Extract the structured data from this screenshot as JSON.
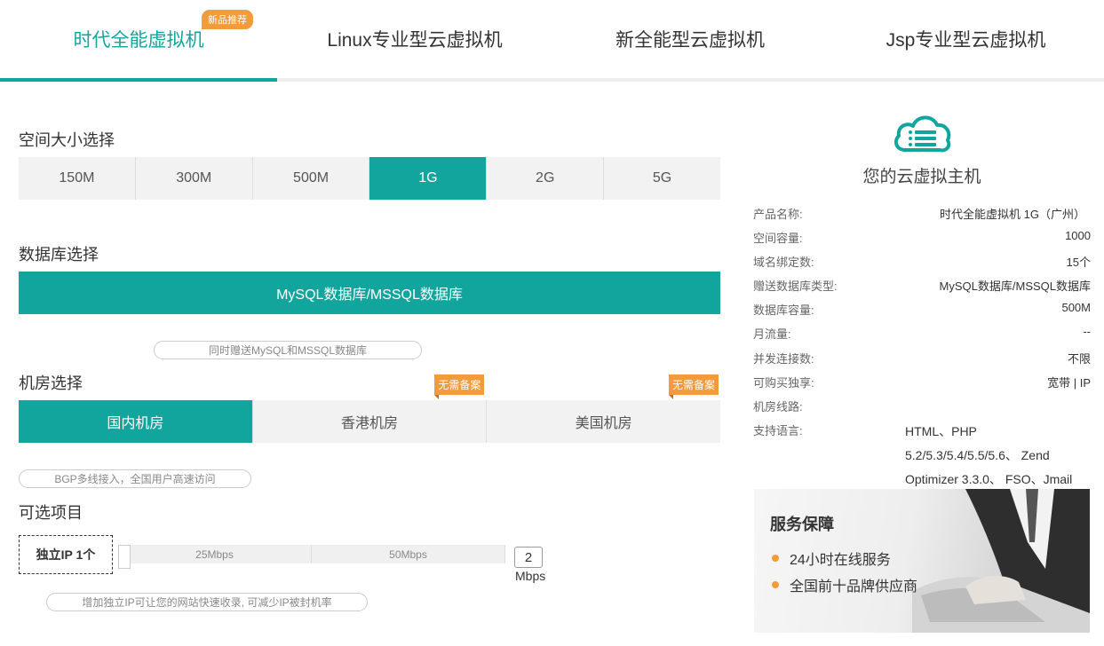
{
  "tabs": [
    {
      "label": "时代全能虚拟机",
      "badge": "新品推荐",
      "active": true
    },
    {
      "label": "Linux专业型云虚拟机"
    },
    {
      "label": "新全能型云虚拟机"
    },
    {
      "label": "Jsp专业型云虚拟机"
    }
  ],
  "space": {
    "title": "空间大小选择",
    "options": [
      "150M",
      "300M",
      "500M",
      "1G",
      "2G",
      "5G"
    ],
    "selected": "1G"
  },
  "database": {
    "title": "数据库选择",
    "option": "MySQL数据库/MSSQL数据库",
    "note": "同时赠送MySQL和MSSQL数据库"
  },
  "room": {
    "title": "机房选择",
    "options": [
      "国内机房",
      "香港机房",
      "美国机房"
    ],
    "selected": "国内机房",
    "badge": "无需备案",
    "note": "BGP多线接入，全国用户高速访问"
  },
  "optional": {
    "title": "可选项目",
    "ip_label": "独立IP 1个",
    "slider_marks": [
      "25Mbps",
      "50Mbps"
    ],
    "value": "2",
    "unit": "Mbps",
    "note": "增加独立IP可让您的网站快速收录, 可减少IP被封机率"
  },
  "summary": {
    "title": "您的云虚拟主机",
    "specs": [
      {
        "k": "产品名称:",
        "v": "时代全能虚拟机 1G（广州）"
      },
      {
        "k": "空间容量:",
        "v": "1000"
      },
      {
        "k": "域名绑定数:",
        "v": "15个"
      },
      {
        "k": "赠送数据库类型:",
        "v": "MySQL数据库/MSSQL数据库"
      },
      {
        "k": "数据库容量:",
        "v": "500M"
      },
      {
        "k": "月流量:",
        "v": "--"
      },
      {
        "k": "并发连接数:",
        "v": "不限"
      },
      {
        "k": "可购买独享:",
        "v": "宽带 | IP"
      },
      {
        "k": "机房线路:",
        "v": ""
      },
      {
        "k": "支持语言:",
        "v": ""
      }
    ],
    "languages": "HTML、PHP 5.2/5.3/5.4/5.5/5.6、 Zend Optimizer 3.3.0、 FSO、Jmail"
  },
  "service": {
    "title": "服务保障",
    "items": [
      "24小时在线服务",
      "全国前十品牌供应商"
    ]
  },
  "colors": {
    "accent": "#12a59e",
    "badge": "#f39a3a"
  }
}
